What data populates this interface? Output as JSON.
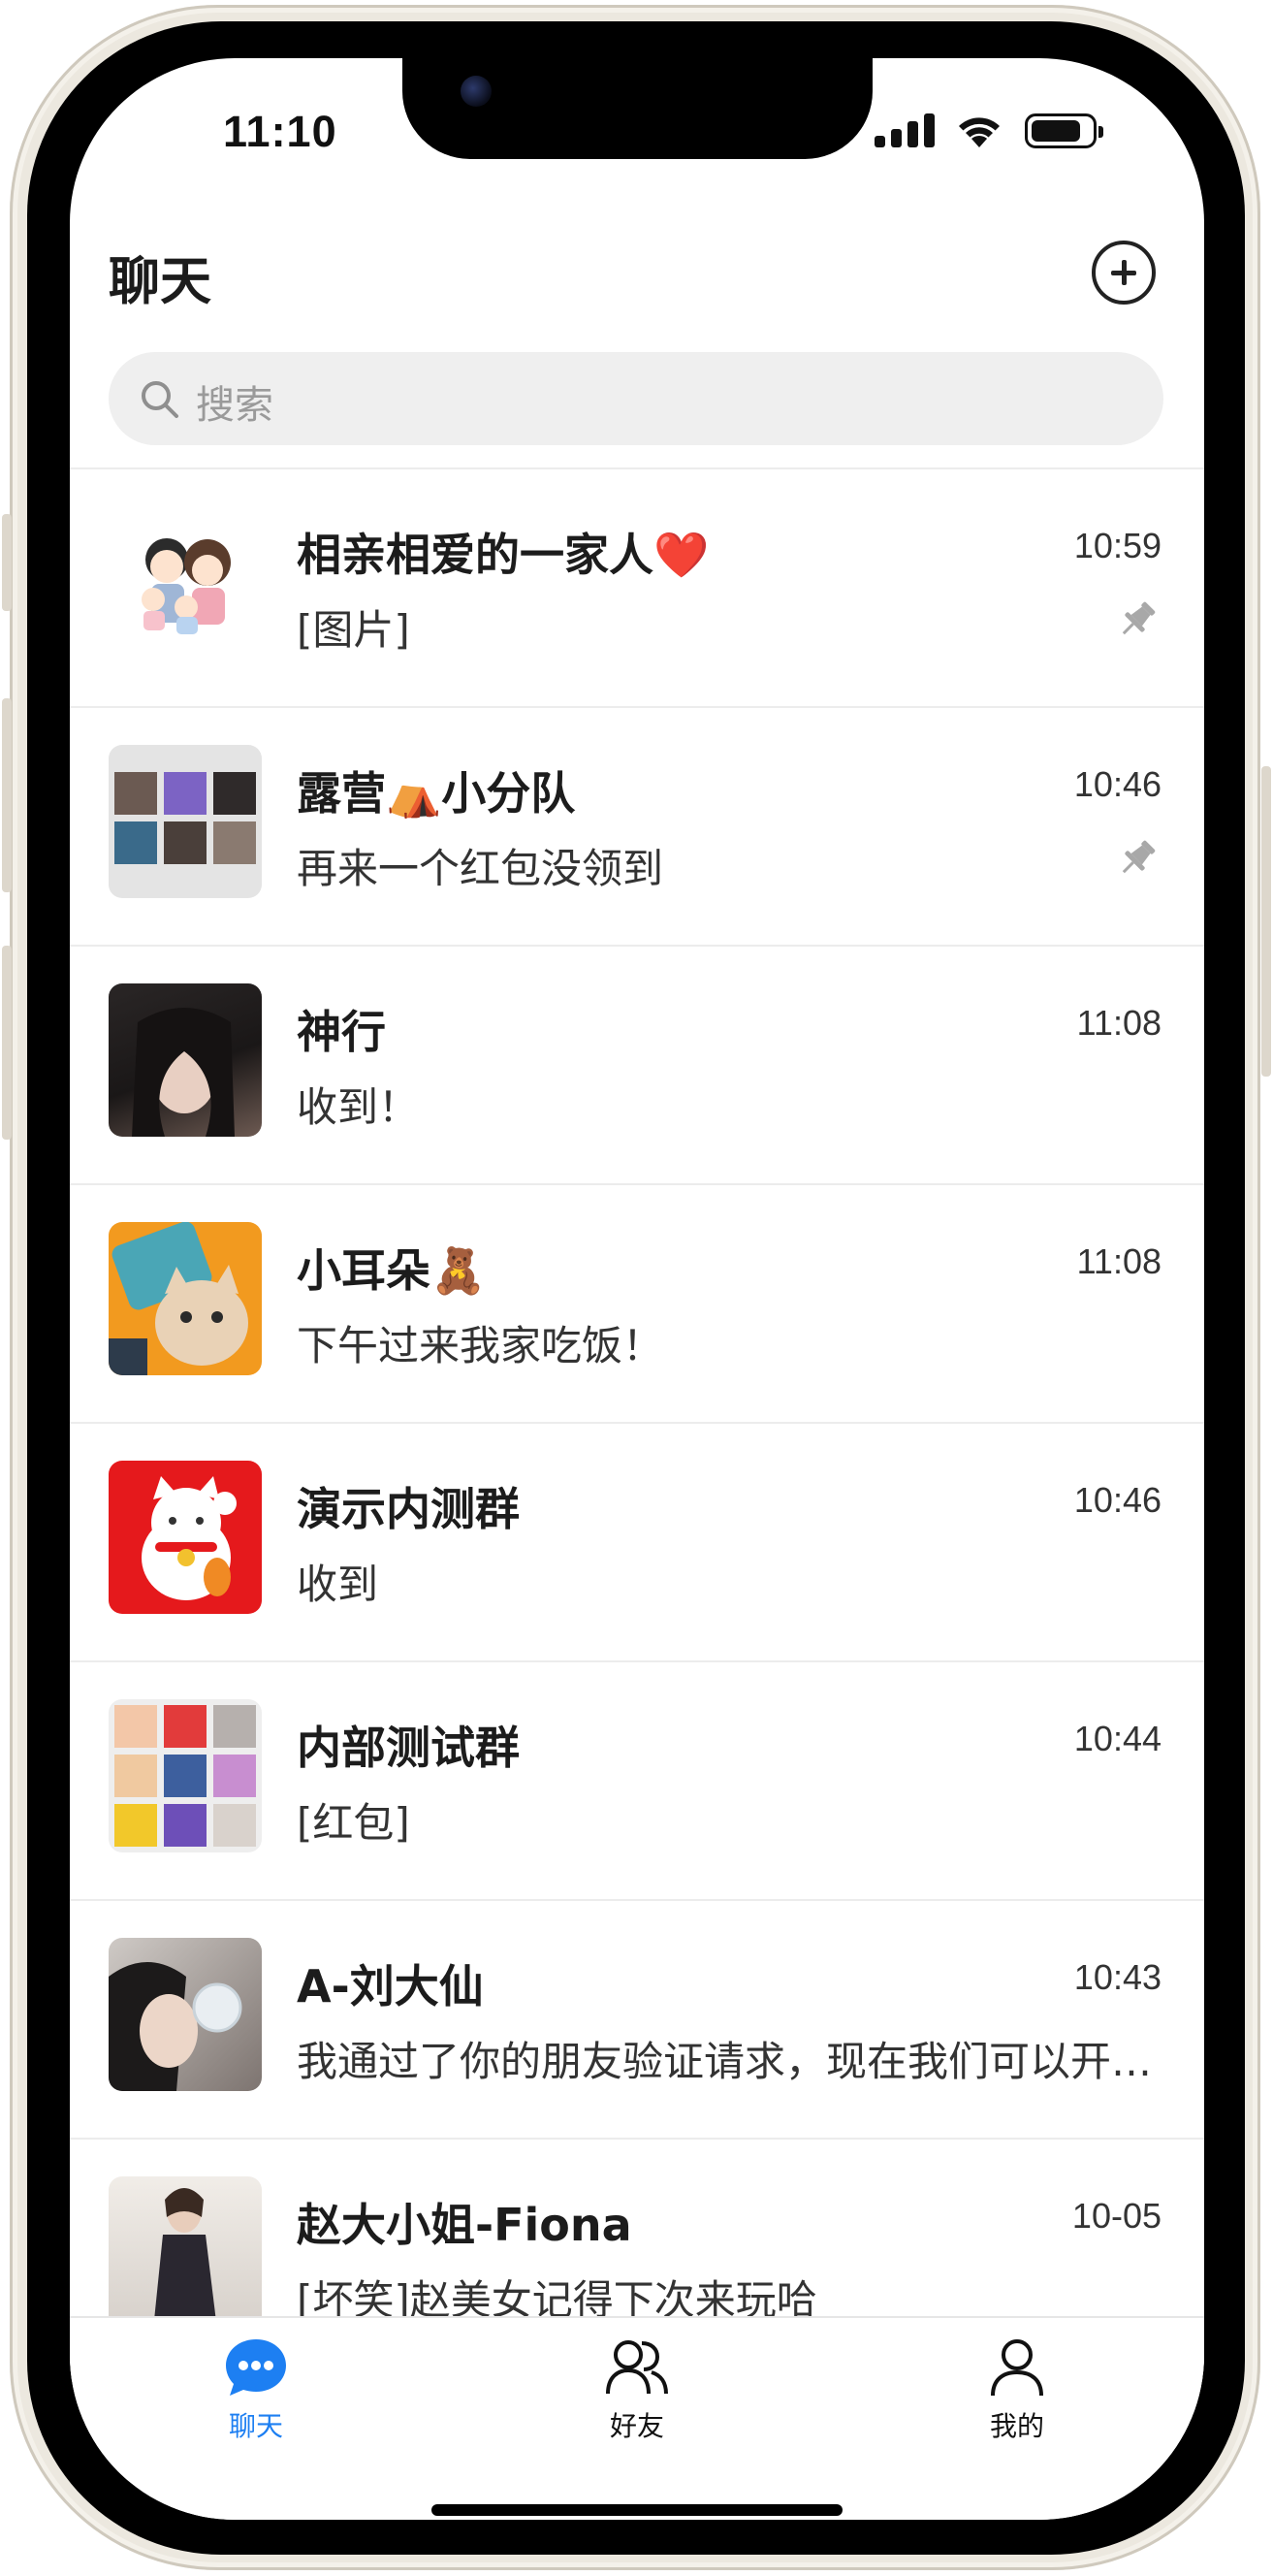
{
  "status_bar": {
    "time": "11:10"
  },
  "header": {
    "title": "聊天"
  },
  "search": {
    "placeholder": "搜索"
  },
  "chats": [
    {
      "name": "相亲相爱的一家人❤️",
      "preview": "[图片]",
      "time": "10:59",
      "pinned": true,
      "avatar": "family-cartoon-avatar"
    },
    {
      "name": "露营⛺小分队",
      "preview": "再来一个红包没领到",
      "time": "10:46",
      "pinned": true,
      "avatar": "group-collage-avatar"
    },
    {
      "name": "神行",
      "preview": "收到！",
      "time": "11:08",
      "pinned": false,
      "avatar": "photo-avatar"
    },
    {
      "name": "小耳朵🧸",
      "preview": "下午过来我家吃饭！",
      "time": "11:08",
      "pinned": false,
      "avatar": "cat-cartoon-avatar"
    },
    {
      "name": "演示内测群",
      "preview": "收到",
      "time": "10:46",
      "pinned": false,
      "avatar": "lucky-cat-avatar"
    },
    {
      "name": "内部测试群",
      "preview": "[红包]",
      "time": "10:44",
      "pinned": false,
      "avatar": "group-collage-avatar"
    },
    {
      "name": "A-刘大仙",
      "preview": "我通过了你的朋友验证请求，现在我们可以开始聊天了",
      "time": "10:43",
      "pinned": false,
      "avatar": "photo-avatar"
    },
    {
      "name": "赵大小姐-Fiona",
      "preview": "[坏笑]赵美女记得下次来玩哈",
      "time": "10-05",
      "pinned": false,
      "avatar": "photo-avatar"
    }
  ],
  "tabs": [
    {
      "label": "聊天",
      "icon": "chat-bubble-icon",
      "active": true
    },
    {
      "label": "好友",
      "icon": "friends-icon",
      "active": false
    },
    {
      "label": "我的",
      "icon": "person-icon",
      "active": false
    }
  ],
  "colors": {
    "accent": "#1d7ff2",
    "text": "#1c1c1c",
    "search_bg": "#efefef"
  }
}
